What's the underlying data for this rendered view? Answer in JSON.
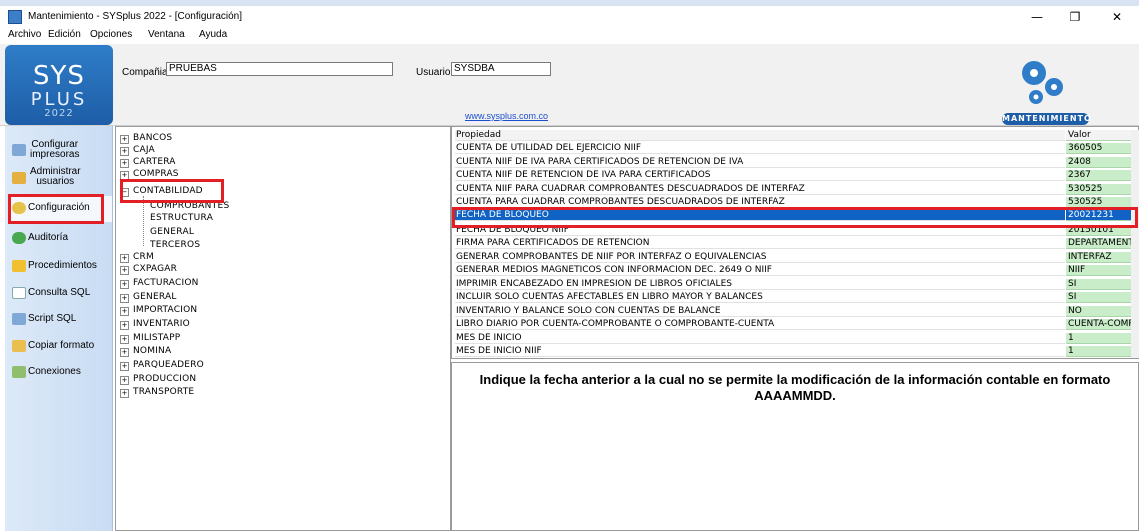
{
  "window": {
    "title": "Mantenimiento - SYSplus 2022 - [Configuración]",
    "minimize": "—",
    "restore": "❐",
    "close": "✕"
  },
  "menu": {
    "items": [
      "Archivo",
      "Edición",
      "Opciones",
      "Ventana",
      "Ayuda"
    ]
  },
  "header": {
    "logo_line1": "SYS",
    "logo_line2": "PLUS",
    "logo_line3": "2022",
    "compania_label": "Compañia:",
    "compania_value": "PRUEBAS",
    "usuario_label": "Usuario:",
    "usuario_value": "SYSDBA",
    "website": "www.sysplus.com.co",
    "badge": "MANTENIMIENTO"
  },
  "nav": {
    "items": [
      {
        "label": "Configurar",
        "label2": "impresoras",
        "icon": "printer-icon",
        "color": "#7fa8d6"
      },
      {
        "label": "Administrar",
        "label2": "usuarios",
        "icon": "users-icon",
        "color": "#e4b040"
      },
      {
        "label": "Configuración",
        "icon": "settings-icon",
        "color": "#e6c24a"
      },
      {
        "label": "Auditoría",
        "icon": "check-icon",
        "color": "#49a84f"
      },
      {
        "label": "Procedimientos",
        "icon": "lightning-icon",
        "color": "#f0c030"
      },
      {
        "label": "Consulta SQL",
        "icon": "sql-icon",
        "color": "#ffffff"
      },
      {
        "label": "Script SQL",
        "icon": "script-icon",
        "color": "#7fa8d6"
      },
      {
        "label": "Copiar formato",
        "icon": "copy-icon",
        "color": "#e9c050"
      },
      {
        "label": "Conexiones",
        "icon": "connections-icon",
        "color": "#8fbf6e"
      }
    ]
  },
  "tree": {
    "nodes_top": [
      "BANCOS",
      "CAJA",
      "CARTERA",
      "COMPRAS"
    ],
    "contabilidad": "CONTABILIDAD",
    "contabilidad_children": [
      "COMPROBANTES",
      "ESTRUCTURA",
      "GENERAL",
      "TERCEROS"
    ],
    "nodes_bottom": [
      "CRM",
      "CXPAGAR",
      "FACTURACION",
      "GENERAL",
      "IMPORTACION",
      "INVENTARIO",
      "MILISTAPP",
      "NOMINA",
      "PARQUEADERO",
      "PRODUCCION",
      "TRANSPORTE"
    ]
  },
  "grid": {
    "header": {
      "prop": "Propiedad",
      "val": "Valor"
    },
    "rows": [
      {
        "prop": "CUENTA DE UTILIDAD DEL EJERCICIO NIIF",
        "val": "360505"
      },
      {
        "prop": "CUENTA NIIF DE IVA PARA CERTIFICADOS DE RETENCION DE IVA",
        "val": "2408"
      },
      {
        "prop": "CUENTA NIIF DE RETENCION DE IVA PARA CERTIFICADOS",
        "val": "2367"
      },
      {
        "prop": "CUENTA NIIF PARA CUADRAR COMPROBANTES DESCUADRADOS DE INTERFAZ",
        "val": "530525"
      },
      {
        "prop": "CUENTA PARA CUADRAR COMPROBANTES DESCUADRADOS DE INTERFAZ",
        "val": "530525"
      },
      {
        "prop": "FECHA DE BLOQUEO",
        "val": "20021231"
      },
      {
        "prop": "FECHA DE BLOQUEO NIIF",
        "val": "20150101"
      },
      {
        "prop": "FIRMA PARA CERTIFICADOS DE RETENCION",
        "val": "DEPARTAMENT"
      },
      {
        "prop": "GENERAR COMPROBANTES DE NIIF POR INTERFAZ O EQUIVALENCIAS",
        "val": "INTERFAZ"
      },
      {
        "prop": "GENERAR MEDIOS MAGNETICOS CON INFORMACION DEC. 2649 O NIIF",
        "val": "NIIF"
      },
      {
        "prop": "IMPRIMIR ENCABEZADO EN IMPRESION DE LIBROS OFICIALES",
        "val": "SI"
      },
      {
        "prop": "INCLUIR SOLO CUENTAS AFECTABLES EN LIBRO MAYOR Y BALANCES",
        "val": "SI"
      },
      {
        "prop": "INVENTARIO Y BALANCE SOLO CON CUENTAS DE BALANCE",
        "val": "NO"
      },
      {
        "prop": "LIBRO DIARIO POR CUENTA-COMPROBANTE O COMPROBANTE-CUENTA",
        "val": "CUENTA-COMP"
      },
      {
        "prop": "MES DE INICIO",
        "val": "1"
      },
      {
        "prop": "MES DE INICIO NIIF",
        "val": "1"
      }
    ]
  },
  "description": "Indique la fecha anterior a la cual no se permite la modificación de la información contable en formato AAAAMMDD.",
  "colors": {
    "selection": "#1063c5",
    "value_bg": "#c9ecc9",
    "highlight": "#e31f26",
    "logo": "#1e5da7"
  }
}
